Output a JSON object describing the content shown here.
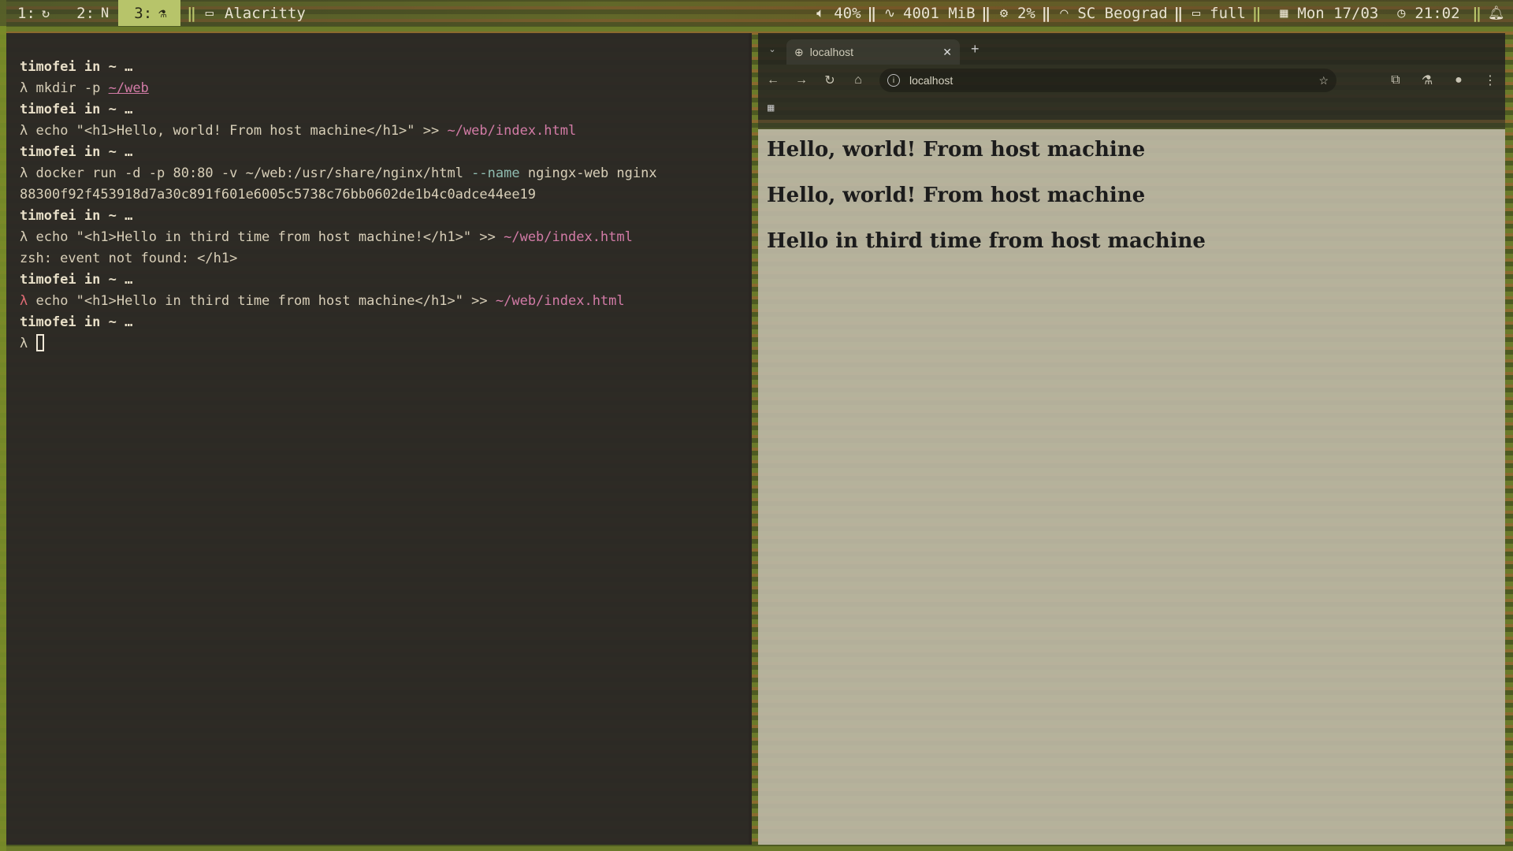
{
  "topbar": {
    "workspaces": [
      {
        "label": "1:",
        "icon": "refresh-icon"
      },
      {
        "label": "2:",
        "icon": "notion-icon"
      },
      {
        "label": "3:",
        "icon": "flask-icon",
        "active": true
      }
    ],
    "window_title": "Alacritty",
    "volume": "40%",
    "memory": "4001 MiB",
    "cpu": "2%",
    "wifi": "SC Beograd",
    "battery": "full",
    "date": "Mon 17/03",
    "time": "21:02"
  },
  "terminal": {
    "user": "timofei",
    "prompt_suffix": " in ~ …",
    "lambda": "λ",
    "cmd1": " mkdir -p ",
    "cmd1_arg": "~/web",
    "cmd2_pre": " echo \"<h1>Hello, world! From host machine</h1>\" >> ",
    "cmd2_path": "~/web/index.html",
    "cmd3_pre": " docker run -d -p 80:80 -v ~/web:/usr/share/nginx/html ",
    "cmd3_flag": "--name",
    "cmd3_post": " ngingx-web nginx",
    "container_id": "88300f92f453918d7a30c891f601e6005c5738c76bb0602de1b4c0adce44ee19",
    "cmd4_pre": " echo \"<h1>Hello in third time from host machine!</h1>\" >> ",
    "cmd4_path": "~/web/index.html",
    "error": "zsh: event not found: </h1>",
    "cmd5_pre": " echo \"<h1>Hello in third time from host machine</h1>\" >> ",
    "cmd5_path": "~/web/index.html"
  },
  "browser": {
    "tab_title": "localhost",
    "url": "localhost",
    "headings": [
      "Hello, world! From host machine",
      "Hello, world! From host machine",
      "Hello in third time from host machine"
    ]
  }
}
